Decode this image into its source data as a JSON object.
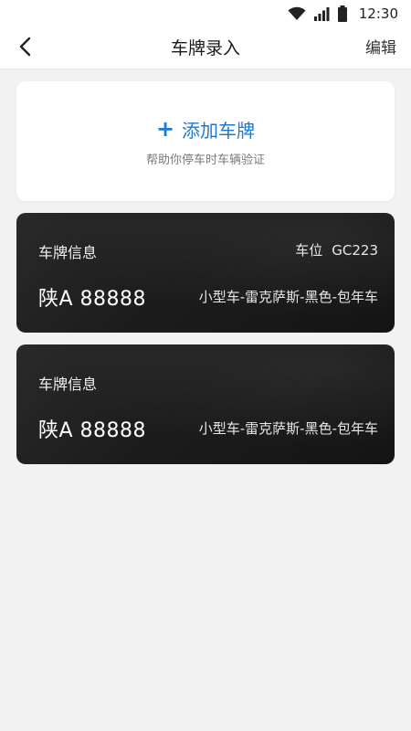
{
  "status_bar": {
    "time": "12:30",
    "icons": [
      "wifi-icon",
      "signal-icon",
      "battery-icon"
    ]
  },
  "nav": {
    "title": "车牌录入",
    "edit_label": "编辑",
    "back_icon": "back-arrow-icon"
  },
  "add_card": {
    "label": "添加车牌",
    "hint": "帮助你停车时车辆验证",
    "accent_color": "#1e78d4"
  },
  "vehicles": [
    {
      "title": "车牌信息",
      "spot_label": "车位",
      "spot_code": "GC223",
      "plate": "陕A 88888",
      "description": "小型车-雷克萨斯-黑色-包年车"
    },
    {
      "title": "车牌信息",
      "plate": "陕A 88888",
      "description": "小型车-雷克萨斯-黑色-包年车"
    }
  ]
}
